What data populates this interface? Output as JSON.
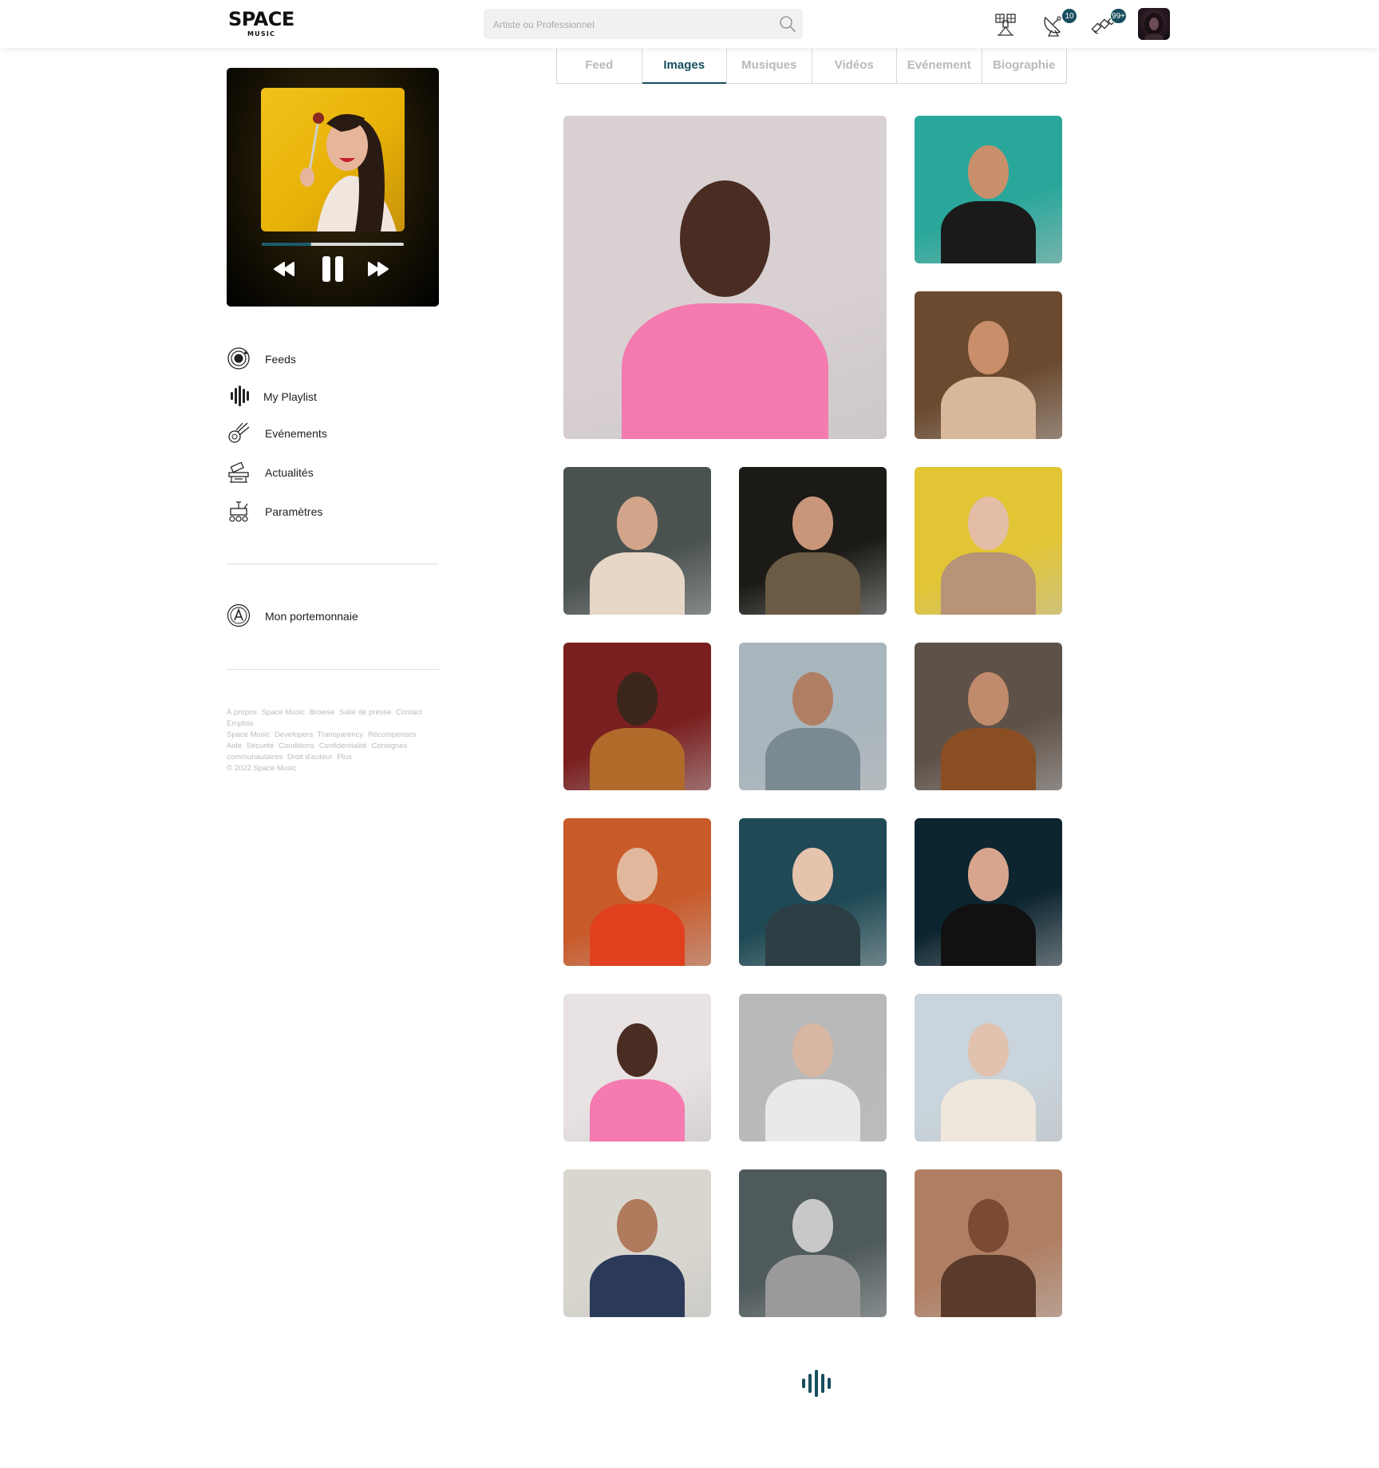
{
  "header": {
    "logo_main": "SPACE",
    "logo_sub": "MUSIC",
    "search_placeholder": "Artiste ou Professionnel",
    "notifications": [
      {
        "icon": "radio-tower-icon",
        "badge": ""
      },
      {
        "icon": "satellite-dish-icon",
        "badge": "10"
      },
      {
        "icon": "satellite-icon",
        "badge": "99+"
      }
    ]
  },
  "tabs": [
    {
      "label": "Feed",
      "active": false
    },
    {
      "label": "Images",
      "active": true
    },
    {
      "label": "Musiques",
      "active": false
    },
    {
      "label": "Vidéos",
      "active": false
    },
    {
      "label": "Evénement",
      "active": false
    },
    {
      "label": "Biographie",
      "active": false
    }
  ],
  "player": {
    "progress": 0.35
  },
  "sidebar": {
    "items": [
      {
        "label": "Feeds",
        "icon": "orbit-icon"
      },
      {
        "label": "My Playlist",
        "icon": "sound-bars-icon"
      },
      {
        "label": "Evénements",
        "icon": "meteor-icon"
      },
      {
        "label": "Actualités",
        "icon": "telescope-icon"
      },
      {
        "label": "Paramètres",
        "icon": "rover-icon"
      }
    ],
    "wallet": {
      "label": "Mon portemonnaie",
      "icon": "wallet-coin-icon"
    }
  },
  "footer": {
    "links": [
      "À propos",
      "Space Music",
      "Browse",
      "Salle de presse",
      "Contact",
      "Emplois",
      "Space Music",
      "Developers",
      "Transparency",
      "Récompenses",
      "Aide",
      "Sécurité",
      "Conditions",
      "Confidentialité",
      "Consignes communautaires",
      "Droit d'auteur",
      "Plus"
    ],
    "copyright": "© 2022 Space Music"
  },
  "gallery": [
    {
      "bg": "#d9d0d2",
      "accent": "#f47ab0",
      "skin": "#4a2c22"
    },
    {
      "bg": "#2aa79a",
      "accent": "#1a1a1a",
      "skin": "#c98f6a"
    },
    {
      "bg": "#6b4a2f",
      "accent": "#d8b79a",
      "skin": "#c98f6a"
    },
    {
      "bg": "#4a5250",
      "accent": "#e7d7c7",
      "skin": "#d2a58a"
    },
    {
      "bg": "#1c1a16",
      "accent": "#6b5b45",
      "skin": "#c9967a"
    },
    {
      "bg": "#e1c534",
      "accent": "#b79377",
      "skin": "#e3bda6"
    },
    {
      "bg": "#7a1f1f",
      "accent": "#b06a2a",
      "skin": "#3c261c"
    },
    {
      "bg": "#a9b6bd",
      "accent": "#7b8a92",
      "skin": "#b07f63"
    },
    {
      "bg": "#5e5147",
      "accent": "#8a4e22",
      "skin": "#c08b6c"
    },
    {
      "bg": "#c95a2a",
      "accent": "#e0401e",
      "skin": "#e1b89c"
    },
    {
      "bg": "#1f4a55",
      "accent": "#2c3e44",
      "skin": "#e6c3ad"
    },
    {
      "bg": "#0d2530",
      "accent": "#111111",
      "skin": "#d7a58d"
    },
    {
      "bg": "#e9e2e3",
      "accent": "#f47ab0",
      "skin": "#4a2c22"
    },
    {
      "bg": "#b9b9b9",
      "accent": "#e9e9e9",
      "skin": "#d9b6a1"
    },
    {
      "bg": "#c9d4dc",
      "accent": "#efe6dc",
      "skin": "#e0c2ae"
    },
    {
      "bg": "#d9d6cf",
      "accent": "#2b3a5a",
      "skin": "#b07a5c"
    },
    {
      "bg": "#4f5a5c",
      "accent": "#9a9a9a",
      "skin": "#c8c8c8"
    },
    {
      "bg": "#b07f63",
      "accent": "#5a3a2a",
      "skin": "#7a4a32"
    }
  ],
  "colors": {
    "accent": "#174e5e",
    "badge": "#174e5e"
  }
}
